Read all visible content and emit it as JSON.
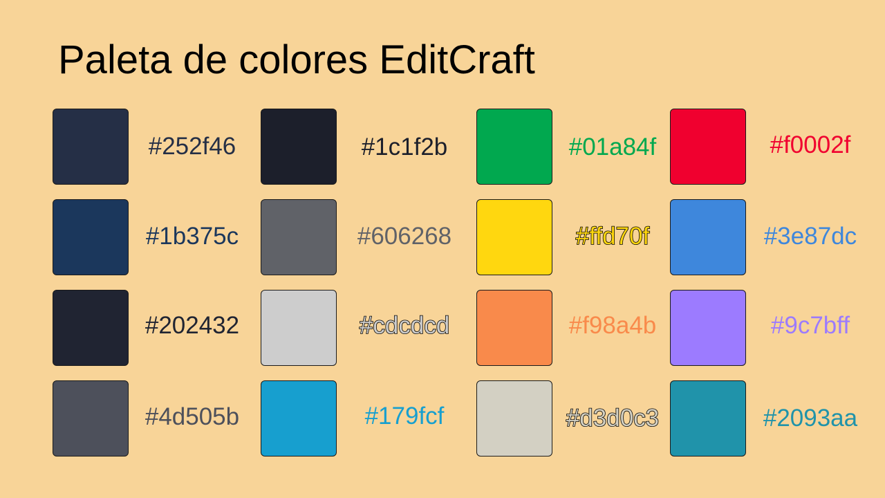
{
  "title": "Paleta de colores EditCraft",
  "colors": [
    {
      "hex": "#252f46",
      "text_color": "#252f46"
    },
    {
      "hex": "#1b375c",
      "text_color": "#1b375c"
    },
    {
      "hex": "#202432",
      "text_color": "#202432"
    },
    {
      "hex": "#4d505b",
      "text_color": "#4d505b"
    },
    {
      "hex": "#1c1f2b",
      "text_color": "#1c1f2b"
    },
    {
      "hex": "#606268",
      "text_color": "#606268"
    },
    {
      "hex": "#cdcdcd",
      "text_color": "#cdcdcd",
      "outlined": true
    },
    {
      "hex": "#179fcf",
      "text_color": "#179fcf"
    },
    {
      "hex": "#01a84f",
      "text_color": "#01a84f"
    },
    {
      "hex": "#ffd70f",
      "text_color": "#ffd70f",
      "outlined": true
    },
    {
      "hex": "#f98a4b",
      "text_color": "#f98a4b"
    },
    {
      "hex": "#d3d0c3",
      "text_color": "#d3d0c3",
      "outlined": true
    },
    {
      "hex": "#f0002f",
      "text_color": "#f0002f"
    },
    {
      "hex": "#3e87dc",
      "text_color": "#3e87dc"
    },
    {
      "hex": "#9c7bff",
      "text_color": "#9c7bff"
    },
    {
      "hex": "#2093aa",
      "text_color": "#2093aa"
    }
  ]
}
